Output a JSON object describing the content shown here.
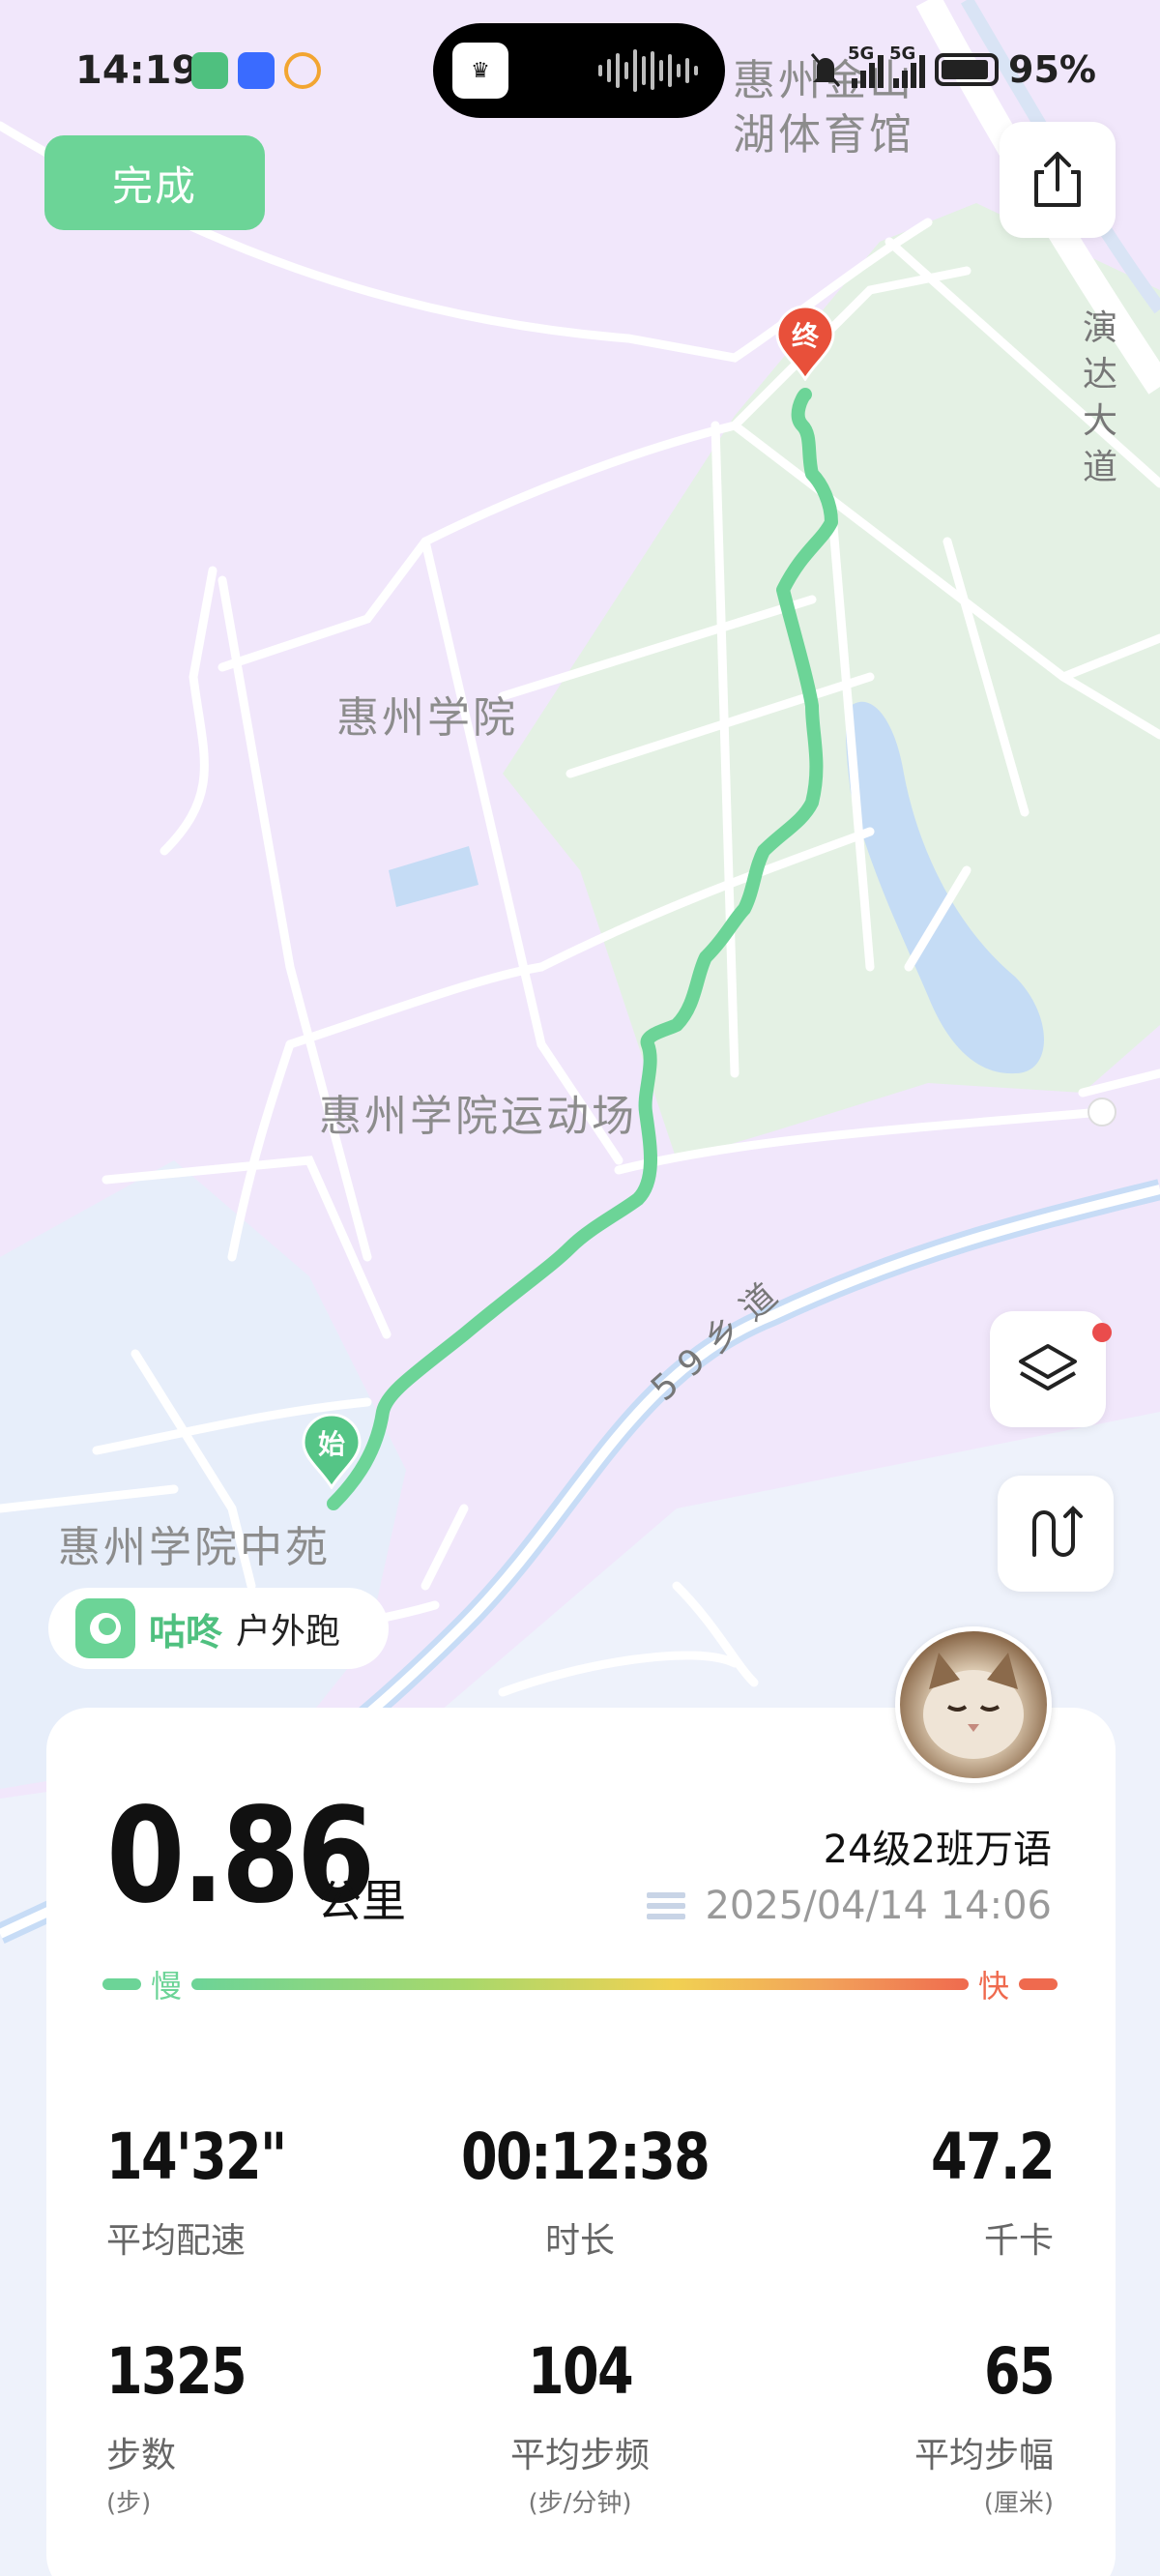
{
  "status_bar": {
    "time": "14:19",
    "network": "5G",
    "battery": "95%",
    "icons": [
      "app-gudong-icon",
      "honor-app-icon",
      "swirl-app-icon",
      "mute-bell-icon",
      "signal-icon",
      "battery-icon"
    ]
  },
  "header": {
    "done_label": "完成"
  },
  "map": {
    "labels": {
      "gym": "惠州金山湖体育馆",
      "road_right": "演达大道",
      "college": "惠州学院",
      "stadium": "惠州学院运动场",
      "township_road": "59乡道",
      "garden": "惠州学院中苑"
    },
    "markers": {
      "start": "始",
      "end": "终"
    },
    "route_color": "#6cd497"
  },
  "brand": {
    "name": "咕咚",
    "sport": "户外跑"
  },
  "summary": {
    "distance": "0.86",
    "distance_unit": "公里",
    "user_name": "24级2班万语",
    "datetime": "2025/04/14 14:06",
    "speed_slow": "慢",
    "speed_fast": "快"
  },
  "stats": [
    {
      "value": "14'32\"",
      "label": "平均配速",
      "sub": ""
    },
    {
      "value": "00:12:38",
      "label": "时长",
      "sub": ""
    },
    {
      "value": "47.2",
      "label": "千卡",
      "sub": ""
    },
    {
      "value": "1325",
      "label": "步数",
      "sub": "(步)"
    },
    {
      "value": "104",
      "label": "平均步频",
      "sub": "(步/分钟)"
    },
    {
      "value": "65",
      "label": "平均步幅",
      "sub": "(厘米)"
    }
  ],
  "colors": {
    "accent": "#6cd497",
    "end_marker": "#e8503a",
    "fast": "#ef6a4e"
  }
}
